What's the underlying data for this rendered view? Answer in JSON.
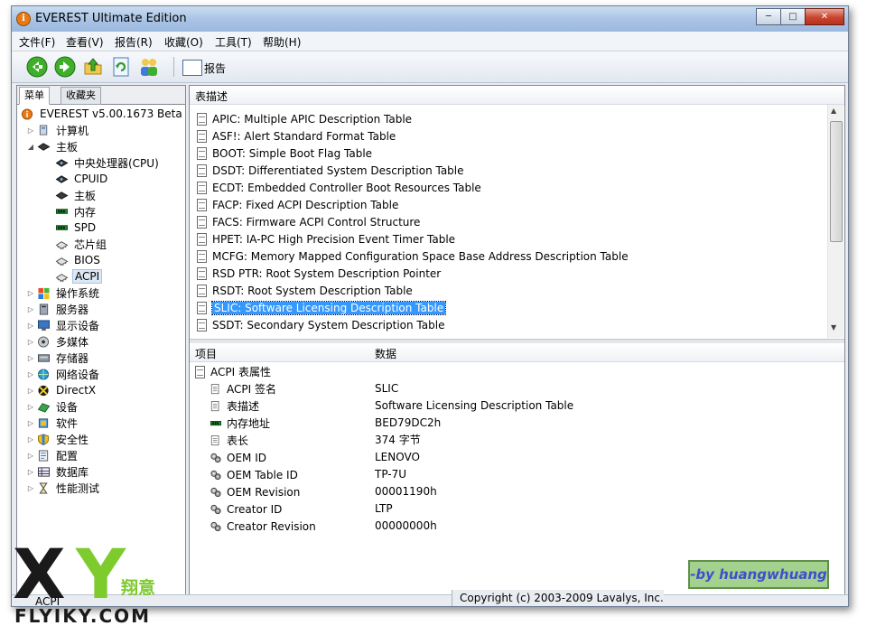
{
  "window": {
    "title": "EVEREST Ultimate Edition"
  },
  "menu": [
    "文件(F)",
    "查看(V)",
    "报告(R)",
    "收藏(O)",
    "工具(T)",
    "帮助(H)"
  ],
  "toolbar": {
    "report_label": "报告"
  },
  "left_tabs": [
    "菜单",
    "收藏夹"
  ],
  "tree": [
    {
      "label": "EVEREST v5.00.1673 Beta",
      "icon": "info-icon",
      "level": 0,
      "expander": ""
    },
    {
      "label": "计算机",
      "icon": "computer-icon",
      "level": 1,
      "expander": "▷"
    },
    {
      "label": "主板",
      "icon": "motherboard-icon",
      "level": 1,
      "expander": "◢"
    },
    {
      "label": "中央处理器(CPU)",
      "icon": "cpu-icon",
      "level": 2,
      "expander": ""
    },
    {
      "label": "CPUID",
      "icon": "cpu-icon",
      "level": 2,
      "expander": ""
    },
    {
      "label": "主板",
      "icon": "motherboard-icon",
      "level": 2,
      "expander": ""
    },
    {
      "label": "内存",
      "icon": "memory-icon",
      "level": 2,
      "expander": ""
    },
    {
      "label": "SPD",
      "icon": "memory-icon",
      "level": 2,
      "expander": ""
    },
    {
      "label": "芯片组",
      "icon": "chip-icon",
      "level": 2,
      "expander": ""
    },
    {
      "label": "BIOS",
      "icon": "chip-icon",
      "level": 2,
      "expander": ""
    },
    {
      "label": "ACPI",
      "icon": "chip-icon",
      "level": 2,
      "expander": "",
      "selected": true
    },
    {
      "label": "操作系统",
      "icon": "windows-icon",
      "level": 1,
      "expander": "▷"
    },
    {
      "label": "服务器",
      "icon": "server-icon",
      "level": 1,
      "expander": "▷"
    },
    {
      "label": "显示设备",
      "icon": "display-icon",
      "level": 1,
      "expander": "▷"
    },
    {
      "label": "多媒体",
      "icon": "multimedia-icon",
      "level": 1,
      "expander": "▷"
    },
    {
      "label": "存储器",
      "icon": "storage-icon",
      "level": 1,
      "expander": "▷"
    },
    {
      "label": "网络设备",
      "icon": "network-icon",
      "level": 1,
      "expander": "▷"
    },
    {
      "label": "DirectX",
      "icon": "directx-icon",
      "level": 1,
      "expander": "▷"
    },
    {
      "label": "设备",
      "icon": "devices-icon",
      "level": 1,
      "expander": "▷"
    },
    {
      "label": "软件",
      "icon": "software-icon",
      "level": 1,
      "expander": "▷"
    },
    {
      "label": "安全性",
      "icon": "security-icon",
      "level": 1,
      "expander": "▷"
    },
    {
      "label": "配置",
      "icon": "config-icon",
      "level": 1,
      "expander": "▷"
    },
    {
      "label": "数据库",
      "icon": "database-icon",
      "level": 1,
      "expander": "▷"
    },
    {
      "label": "性能测试",
      "icon": "benchmark-icon",
      "level": 1,
      "expander": "▷"
    }
  ],
  "table_header": "表描述",
  "tables": [
    {
      "text": "APIC: Multiple APIC Description Table"
    },
    {
      "text": "ASF!: Alert Standard Format Table"
    },
    {
      "text": "BOOT: Simple Boot Flag Table"
    },
    {
      "text": "DSDT: Differentiated System Description Table"
    },
    {
      "text": "ECDT: Embedded Controller Boot Resources Table"
    },
    {
      "text": "FACP: Fixed ACPI Description Table"
    },
    {
      "text": "FACS: Firmware ACPI Control Structure"
    },
    {
      "text": "HPET: IA-PC High Precision Event Timer Table"
    },
    {
      "text": "MCFG: Memory Mapped Configuration Space Base Address Description Table"
    },
    {
      "text": "RSD PTR: Root System Description Pointer"
    },
    {
      "text": "RSDT: Root System Description Table"
    },
    {
      "text": "SLIC: Software Licensing Description Table",
      "selected": true
    },
    {
      "text": "SSDT: Secondary System Description Table"
    }
  ],
  "detail_header": {
    "item": "项目",
    "value": "数据"
  },
  "props_group": "ACPI 表属性",
  "props": [
    {
      "name": "ACPI 签名",
      "value": "SLIC",
      "icon": "doc-icon"
    },
    {
      "name": "表描述",
      "value": "Software Licensing Description Table",
      "icon": "doc-icon"
    },
    {
      "name": "内存地址",
      "value": "BED79DC2h",
      "icon": "memory-icon"
    },
    {
      "name": "表长",
      "value": "374 字节",
      "icon": "doc-icon"
    },
    {
      "name": "OEM ID",
      "value": "LENOVO",
      "icon": "gear-icon"
    },
    {
      "name": "OEM Table ID",
      "value": "TP-7U",
      "icon": "gear-icon"
    },
    {
      "name": "OEM Revision",
      "value": "00001190h",
      "icon": "gear-icon"
    },
    {
      "name": "Creator ID",
      "value": "LTP",
      "icon": "gear-icon"
    },
    {
      "name": "Creator Revision",
      "value": "00000000h",
      "icon": "gear-icon"
    }
  ],
  "status": {
    "left": "ACPI",
    "right": "Copyright (c) 2003-2009 Lavalys, Inc."
  },
  "brand_box": "-by huangwhuang",
  "watermark": {
    "x": "X",
    "y": "Y",
    "cn": "翔意",
    "en": "FLYIKY.COM"
  },
  "colors": {
    "selection": "#3399ff",
    "accent_green": "#7ecb2e",
    "title_gradient": "#a9c3e4"
  }
}
